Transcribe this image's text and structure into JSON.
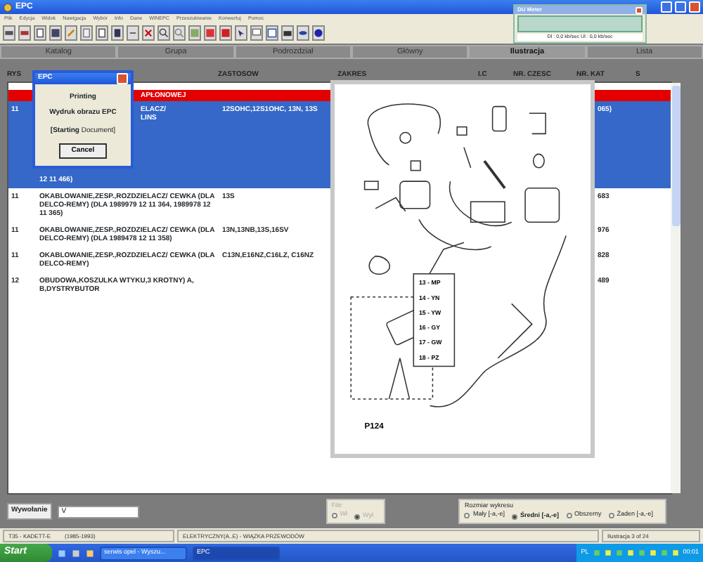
{
  "window": {
    "title": "EPC"
  },
  "menu": [
    "Plik",
    "Edycja",
    "Widok",
    "Nawigacja",
    "Wybór",
    "Info",
    "Dane",
    "WINEPC",
    "Przeszukiwanie",
    "Konwertuj",
    "Pomoc"
  ],
  "tabs": [
    {
      "label": "Katalog",
      "selected": false
    },
    {
      "label": "Grupa",
      "selected": false
    },
    {
      "label": "Podrozdział",
      "selected": false
    },
    {
      "label": "Główny",
      "selected": false
    },
    {
      "label": "Ilustracja",
      "selected": true
    },
    {
      "label": "Lista",
      "selected": false
    }
  ],
  "table": {
    "columns": {
      "rys": "RYS",
      "zastosow": "ZASTOSOW",
      "zakres": "ZAKRES",
      "ic": "I.C",
      "nr_czesc": "NR. CZESC",
      "nr_kat": "NR. KAT",
      "s": "S"
    },
    "rows": [
      {
        "kind": "group",
        "description": "APŁONOWEJ"
      },
      {
        "kind": "part",
        "selected": true,
        "rys": "11",
        "description_visible": [
          "ELACZ/",
          "LINS"
        ],
        "description": "12 11 466)",
        "zastosow": "12SOHC,12S1OHC, 13N, 13S",
        "nr_kat": "065)"
      },
      {
        "kind": "part",
        "selected": false,
        "rys": "11",
        "description": "OKABLOWANIE,ZESP.,ROZDZIELACZ/ CEWKA (DLA DELCO-REMY) (DLA 1989979 12 11 364, 1989978 12 11 365)",
        "zastosow": "13S",
        "nr_kat": "683"
      },
      {
        "kind": "part",
        "selected": false,
        "rys": "11",
        "description": "OKABLOWANIE,ZESP.,ROZDZIELACZ/ CEWKA (DLA DELCO-REMY) (DLA 1989478 12 11 358)",
        "zastosow": "13N,13NB,13S,16SV",
        "nr_kat": "976"
      },
      {
        "kind": "part",
        "selected": false,
        "rys": "11",
        "description": "OKABLOWANIE,ZESP.,ROZDZIELACZ/ CEWKA (DLA DELCO-REMY)",
        "zastosow": "C13N,E16NZ,C16LZ, C16NZ",
        "nr_kat": "828"
      },
      {
        "kind": "part",
        "selected": false,
        "rys": "12",
        "description": "OBUDOWA,KOSZULKA WTYKU,3 KROTNY) A, B,DYSTRYBUTOR",
        "zastosow": "",
        "nr_kat": "489"
      }
    ]
  },
  "print_dialog": {
    "title": "EPC",
    "lines": [
      "Printing",
      "Wydruk obrazu EPC"
    ],
    "status": "**[Starting** Document]",
    "cancel": "Cancel"
  },
  "illustration": {
    "callouts": [
      "13 - MP",
      "14 - YN",
      "15 - YW",
      "16 - GY",
      "17 - GW",
      "18 - PZ"
    ],
    "figure": "P124"
  },
  "du_meter": {
    "title": "DU Meter",
    "reading": "Dl : 0,0 kb/sec   Ul : 0,0 kb/sec"
  },
  "call_field": {
    "label": "Wywołanie",
    "value": "V"
  },
  "filter": {
    "title": "Filtr",
    "disabled": true,
    "options": [
      {
        "label": "Wł",
        "selected": false
      },
      {
        "label": "Wył",
        "selected": true
      }
    ]
  },
  "chart_size": {
    "title": "Rozmiar wykresu",
    "options": [
      {
        "label": "Mały [-a,-e]",
        "selected": false
      },
      {
        "label": "Średni [-a,-e]",
        "selected": true
      },
      {
        "label": "Obszerny",
        "selected": false
      },
      {
        "label": "Żaden [-a,-e]",
        "selected": false
      }
    ]
  },
  "status_bar": [
    "T35 - KADETT-E",
    "(1985-1993)",
    "ELEKTRYCZNY(A..E) - WIĄZKA PRZEWODÓW",
    "Ilustracja 3 of 24"
  ],
  "taskbar": {
    "start": "Start",
    "tasks": [
      {
        "label": "serwis opel - Wyszu...",
        "selected": false
      },
      {
        "label": "EPC",
        "selected": true
      }
    ],
    "language": "PL",
    "clock": "00:01"
  }
}
